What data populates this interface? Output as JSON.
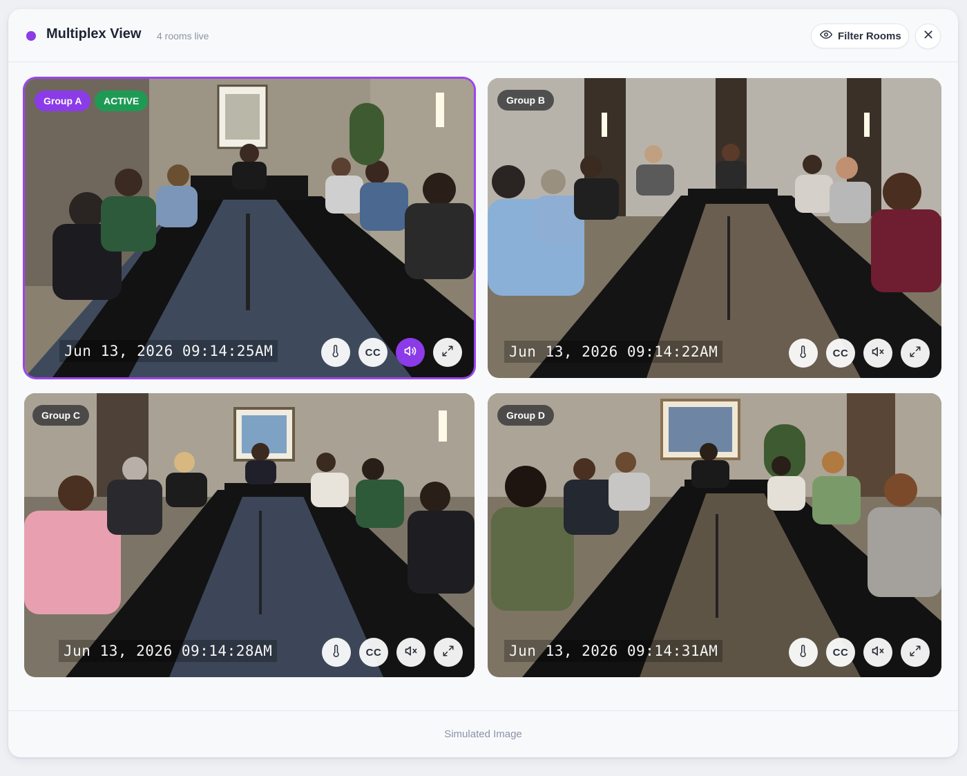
{
  "header": {
    "title": "Multiplex View",
    "subtitle": "4 rooms live",
    "filter_label": "Filter Rooms",
    "filter_icon": "eye-icon",
    "close_icon": "close-icon",
    "live_dot_color": "#8b3be8"
  },
  "tiles": [
    {
      "group": "Group A",
      "status": "ACTIVE",
      "timestamp": "Jun 13, 2026 09:14:25AM",
      "audio": "on",
      "cc_label": "CC",
      "scene": "Conference room, U-shaped table with black tablecloth, participants seated around it, framed painting on wall"
    },
    {
      "group": "Group B",
      "timestamp": "Jun 13, 2026 09:14:22AM",
      "audio": "muted",
      "cc_label": "CC",
      "scene": "Conference room with textured wall panels and wall sconces, U-shaped table, participants"
    },
    {
      "group": "Group C",
      "timestamp": "Jun 13, 2026 09:14:28AM",
      "audio": "muted",
      "cc_label": "CC",
      "scene": "Conference room with landscape painting, U-shaped table, participants"
    },
    {
      "group": "Group D",
      "timestamp": "Jun 13, 2026 09:14:31AM",
      "audio": "muted",
      "cc_label": "CC",
      "scene": "Conference room with abstract painting and plant, U-shaped table, participants"
    }
  ],
  "footer": {
    "caption": "Simulated Image"
  },
  "colors": {
    "accent": "#8b3be8",
    "active_badge": "#1f9a55"
  }
}
